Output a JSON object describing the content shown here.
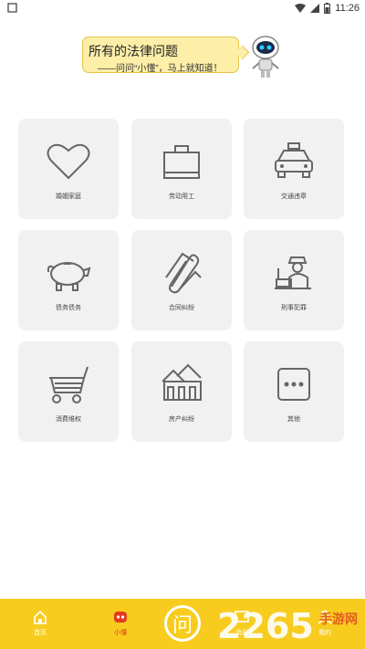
{
  "status": {
    "time": "11:26"
  },
  "banner": {
    "title": "所有的法律问题",
    "subtitle": "——问问“小懂”，马上就知道！"
  },
  "categories": [
    {
      "label": "婚姻家庭",
      "icon": "heart-icon"
    },
    {
      "label": "劳动用工",
      "icon": "briefcase-icon"
    },
    {
      "label": "交通违章",
      "icon": "taxi-icon"
    },
    {
      "label": "债务债务",
      "icon": "piggy-bank-icon"
    },
    {
      "label": "合同纠纷",
      "icon": "paperclip-icon"
    },
    {
      "label": "刑事犯罪",
      "icon": "officer-icon"
    },
    {
      "label": "消费维权",
      "icon": "shopping-cart-icon"
    },
    {
      "label": "房产纠纷",
      "icon": "house-icon"
    },
    {
      "label": "其他",
      "icon": "more-icon"
    }
  ],
  "tabs": [
    {
      "label": "首页",
      "icon": "home-icon"
    },
    {
      "label": "小懂",
      "icon": "robot-icon"
    },
    {
      "label": "问",
      "icon": "ask-button"
    },
    {
      "label": "消息",
      "icon": "message-icon"
    },
    {
      "label": "我的",
      "icon": "profile-icon"
    }
  ],
  "watermark": {
    "number": "2265",
    "text": "手游网"
  },
  "colors": {
    "accent": "#f7cc1e",
    "card": "#f1f1f1"
  }
}
